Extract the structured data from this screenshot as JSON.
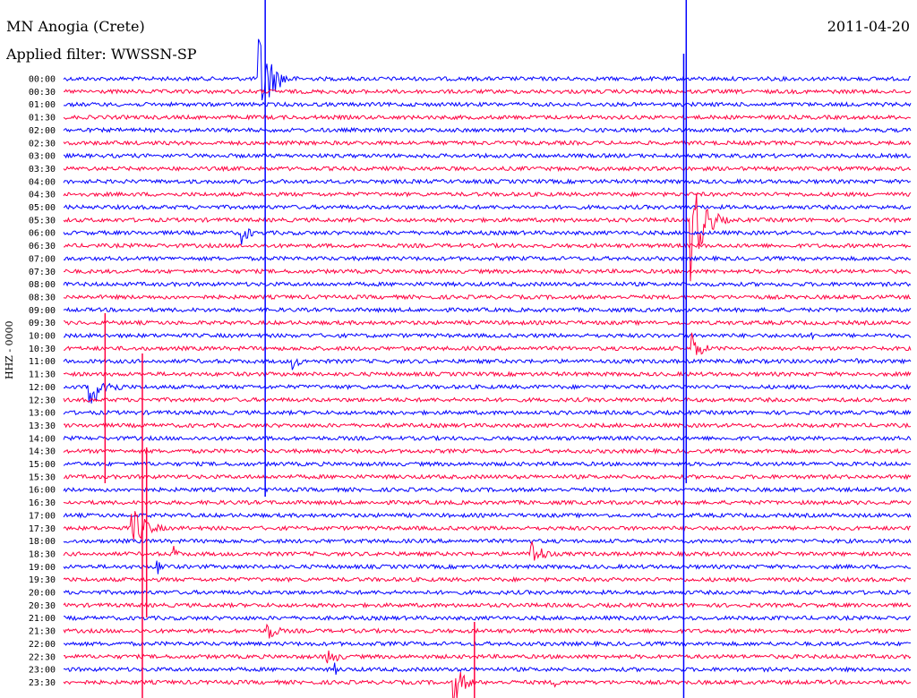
{
  "header": {
    "station": "MN Anogia (Crete)",
    "date": "2011-04-20",
    "filter": "Applied filter: WWSSN-SP",
    "channel": "HHZ - 0000"
  },
  "chart_data": {
    "type": "line",
    "title": "MN Anogia (Crete)",
    "subtitle": "Applied filter: WWSSN-SP",
    "ylabel": "HHZ - 0000",
    "colors": {
      "even": "#0000ff",
      "odd": "#ff0040"
    },
    "grid": false,
    "rows": [
      "00:00",
      "00:30",
      "01:00",
      "01:30",
      "02:00",
      "02:30",
      "03:00",
      "03:30",
      "04:00",
      "04:30",
      "05:00",
      "05:30",
      "06:00",
      "06:30",
      "07:00",
      "07:30",
      "08:00",
      "08:30",
      "09:00",
      "09:30",
      "10:00",
      "10:30",
      "11:00",
      "11:30",
      "12:00",
      "12:30",
      "13:00",
      "13:30",
      "14:00",
      "14:30",
      "15:00",
      "15:30",
      "16:00",
      "16:30",
      "17:00",
      "17:30",
      "18:00",
      "18:30",
      "19:00",
      "19:30",
      "20:00",
      "20:30",
      "21:00",
      "21:30",
      "22:00",
      "22:30",
      "23:00",
      "23:30"
    ],
    "events": [
      {
        "row": 0,
        "t": 0.23,
        "amp": 60,
        "len": 0.05
      },
      {
        "row": 12,
        "t": 0.21,
        "amp": 16,
        "len": 0.03
      },
      {
        "row": 11,
        "t": 0.74,
        "amp": 70,
        "len": 0.05
      },
      {
        "row": 21,
        "t": 0.74,
        "amp": 22,
        "len": 0.04
      },
      {
        "row": 22,
        "t": 0.27,
        "amp": 10,
        "len": 0.04
      },
      {
        "row": 24,
        "t": 0.03,
        "amp": 24,
        "len": 0.07
      },
      {
        "row": 35,
        "t": 0.08,
        "amp": 26,
        "len": 0.06
      },
      {
        "row": 37,
        "t": 0.55,
        "amp": 20,
        "len": 0.05
      },
      {
        "row": 38,
        "t": 0.11,
        "amp": 10,
        "len": 0.04
      },
      {
        "row": 43,
        "t": 0.24,
        "amp": 14,
        "len": 0.04
      },
      {
        "row": 45,
        "t": 0.31,
        "amp": 12,
        "len": 0.05
      },
      {
        "row": 47,
        "t": 0.46,
        "amp": 28,
        "len": 0.04
      },
      {
        "row": 20,
        "t": 0.88,
        "amp": 8,
        "len": 0.02
      },
      {
        "row": 22,
        "t": 0.93,
        "amp": 12,
        "len": 0.02
      },
      {
        "row": 37,
        "t": 0.13,
        "amp": 10,
        "len": 0.02
      },
      {
        "row": 46,
        "t": 0.32,
        "amp": 8,
        "len": 0.02
      },
      {
        "row": 47,
        "t": 0.58,
        "amp": 6,
        "len": 0.03
      }
    ]
  }
}
